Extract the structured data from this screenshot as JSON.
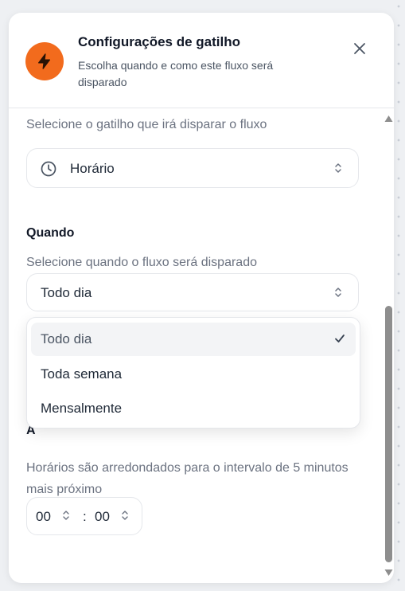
{
  "header": {
    "title": "Configurações de gatilho",
    "subtitle": "Escolha quando e como este fluxo será disparado"
  },
  "trigger": {
    "hint": "Selecione o gatilho que irá disparar o fluxo",
    "selected": "Horário"
  },
  "when": {
    "title": "Quando",
    "hint": "Selecione quando o fluxo será disparado",
    "selected": "Todo dia",
    "options": [
      "Todo dia",
      "Toda semana",
      "Mensalmente"
    ]
  },
  "time": {
    "hint": "Horários são arredondados para o intervalo de 5 minutos mais próximo",
    "hours": "00",
    "separator": ":",
    "minutes": "00"
  },
  "colors": {
    "accent": "#f26b1d",
    "scroll_thumb": "#8e8e8e"
  },
  "icons": {
    "trigger": "bolt-icon",
    "close": "close-icon",
    "clock": "clock-icon",
    "chevrons": "chevrons-up-down-icon",
    "check": "check-icon"
  }
}
